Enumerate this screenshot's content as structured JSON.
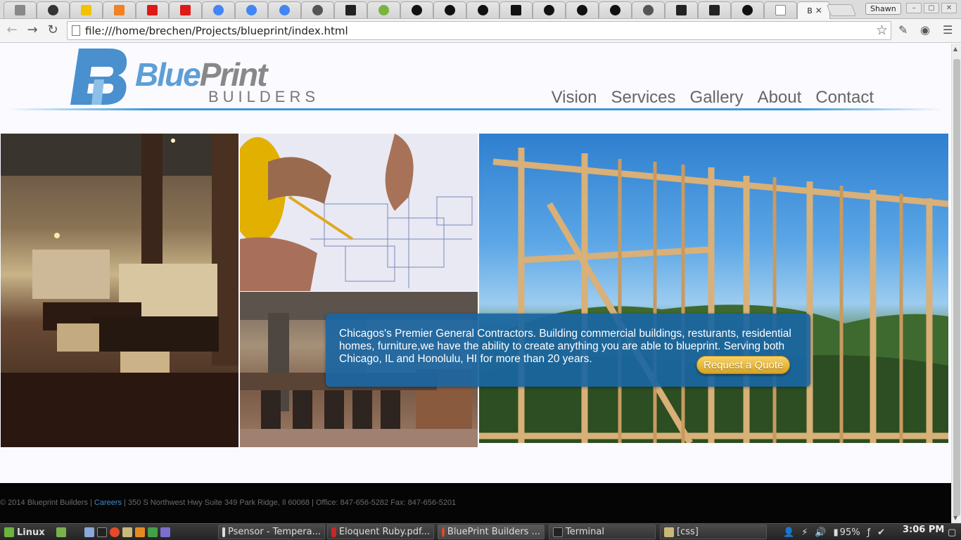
{
  "browser": {
    "active_tab_title": "B",
    "user_label": "Shawn",
    "url": "file:///home/brechen/Projects/blueprint/index.html"
  },
  "site": {
    "logo_word1": "Blue",
    "logo_word2": "Print",
    "logo_sub": "BUILDERS",
    "nav": [
      "Vision",
      "Services",
      "Gallery",
      "About",
      "Contact"
    ],
    "callout_text": "Chicagos's Premier General Contractors. Building commercial buildings, resturants, residential homes, furniture,we have the ability to create anything you are able to blueprint. Serving both Chicago, IL and Honolulu, HI for more than 20 years.",
    "quote_button": "Request a Quote",
    "footer_copyright": "© 2014 Blueprint Builders |",
    "footer_link": "Careers",
    "footer_address": "| 350 S Northwest Hwy Suite 349 Park Ridge, Il 60068 | Office: 847-656-5282 Fax: 847-656-5201",
    "accent_color": "#3d9ad6"
  },
  "taskbar": {
    "menu_label": "Linux",
    "windows": [
      "Psensor - Tempera...",
      "Eloquent Ruby.pdf...",
      "BluePrint Builders ...",
      "Terminal",
      "[css]"
    ],
    "battery": "95%",
    "clock": "3:06 PM"
  }
}
